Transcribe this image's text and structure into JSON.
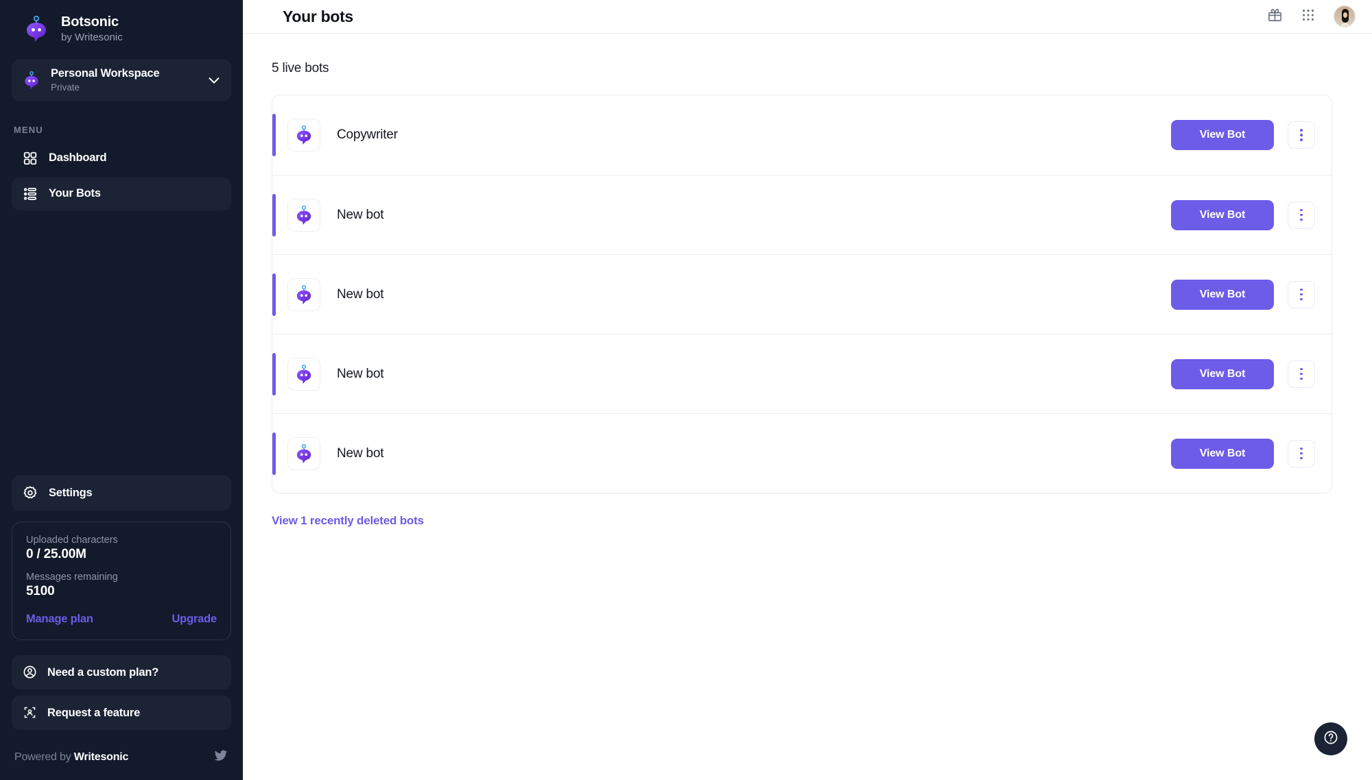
{
  "sidebar": {
    "brand": {
      "title": "Botsonic",
      "subtitle": "by Writesonic",
      "logo_icon": "botsonic-logo-icon"
    },
    "workspace": {
      "name": "Personal Workspace",
      "visibility": "Private",
      "icon": "workspace-bot-icon",
      "chevron_icon": "chevron-down-icon"
    },
    "menu_label": "MENU",
    "items": [
      {
        "label": "Dashboard",
        "icon": "dashboard-grid-icon",
        "active": false
      },
      {
        "label": "Your Bots",
        "icon": "your-bots-list-icon",
        "active": true
      }
    ],
    "settings": {
      "label": "Settings",
      "icon": "gear-icon"
    },
    "usage": {
      "uploaded_label": "Uploaded characters",
      "uploaded_value": "0 / 25.00M",
      "messages_label": "Messages remaining",
      "messages_value": "5100",
      "manage_plan_label": "Manage plan",
      "upgrade_label": "Upgrade"
    },
    "actions": [
      {
        "label": "Need a custom plan?",
        "icon": "user-circle-icon"
      },
      {
        "label": "Request a feature",
        "icon": "feature-request-icon"
      }
    ],
    "footer": {
      "prefix": "Powered by ",
      "brand": "Writesonic",
      "social_icon": "twitter-icon"
    }
  },
  "header": {
    "title": "Your bots",
    "gift_icon": "gift-icon",
    "apps_icon": "apps-grid-icon",
    "avatar_icon": "user-avatar"
  },
  "main": {
    "live_count": "5 live bots",
    "view_bot_label": "View Bot",
    "kebab_icon": "more-vertical-icon",
    "bot_avatar_icon": "bot-avatar-icon",
    "bots": [
      {
        "name": "Copywriter"
      },
      {
        "name": "New bot"
      },
      {
        "name": "New bot"
      },
      {
        "name": "New bot"
      },
      {
        "name": "New bot"
      }
    ],
    "deleted_link": "View 1 recently deleted bots",
    "help_icon": "help-question-icon"
  },
  "colors": {
    "accent": "#6c5ce7",
    "sidebar_bg": "#131a2b",
    "sidebar_card": "#1b2335"
  }
}
